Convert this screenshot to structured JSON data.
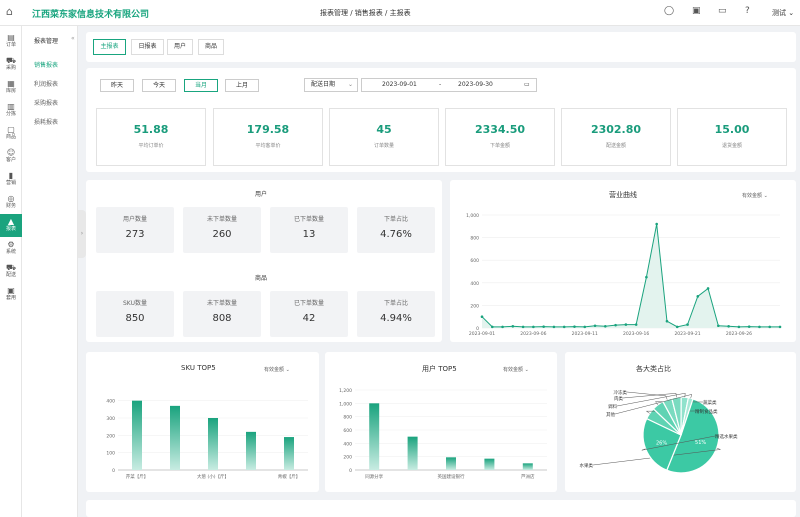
{
  "header": {
    "company": "江西菜东家信息技术有限公司",
    "breadcrumb": "报表管理 / 销售报表 / 主报表",
    "user": "测试 ⌄"
  },
  "sidebar": {
    "items": [
      {
        "label": "订单",
        "icon": "order-icon"
      },
      {
        "label": "采购",
        "icon": "cart-icon"
      },
      {
        "label": "库房",
        "icon": "warehouse-icon"
      },
      {
        "label": "分拣",
        "icon": "sort-icon"
      },
      {
        "label": "商品",
        "icon": "box-icon"
      },
      {
        "label": "客户",
        "icon": "customer-icon"
      },
      {
        "label": "营销",
        "icon": "marketing-icon"
      },
      {
        "label": "财务",
        "icon": "finance-icon"
      },
      {
        "label": "报表",
        "icon": "report-icon"
      },
      {
        "label": "系统",
        "icon": "system-icon"
      },
      {
        "label": "配送",
        "icon": "delivery-icon"
      },
      {
        "label": "套用",
        "icon": "apply-icon"
      }
    ],
    "active": 8
  },
  "subnav": {
    "title": "报表管理",
    "collapse": "«",
    "items": [
      "销售报表",
      "利润报表",
      "采购报表",
      "损耗报表"
    ],
    "active": 0
  },
  "tabs": [
    "主报表",
    "日报表",
    "用户",
    "商品"
  ],
  "period_buttons": [
    "昨天",
    "今天",
    "当月",
    "上月"
  ],
  "date_type": {
    "value": "配送日期",
    "arrow": "⌄"
  },
  "date_range": {
    "start": "2023-09-01",
    "sep": "-",
    "end": "2023-09-30",
    "icon": "calendar-icon"
  },
  "stats": [
    {
      "value": "51.88",
      "label": "平均订单价"
    },
    {
      "value": "179.58",
      "label": "平均客单价"
    },
    {
      "value": "45",
      "label": "订单数量"
    },
    {
      "value": "2334.50",
      "label": "下单金额"
    },
    {
      "value": "2302.80",
      "label": "配送金额"
    },
    {
      "value": "15.00",
      "label": "退货金额"
    }
  ],
  "user_section": {
    "title": "用户",
    "metrics": [
      {
        "label": "用户数量",
        "value": "273"
      },
      {
        "label": "未下单数量",
        "value": "260"
      },
      {
        "label": "已下单数量",
        "value": "13"
      },
      {
        "label": "下单占比",
        "value": "4.76%"
      }
    ]
  },
  "goods_section": {
    "title": "商品",
    "metrics": [
      {
        "label": "SKU数量",
        "value": "850"
      },
      {
        "label": "未下单数量",
        "value": "808"
      },
      {
        "label": "已下单数量",
        "value": "42"
      },
      {
        "label": "下单占比",
        "value": "4.94%"
      }
    ]
  },
  "filter_label": "有效金额",
  "filter_arrow": "⌄",
  "accent": "#19a57f",
  "chart_data": [
    {
      "type": "area",
      "title": "营业曲线",
      "yticks": [
        "0",
        "200",
        "400",
        "600",
        "800",
        "1,000"
      ],
      "ylim": [
        0,
        1000
      ],
      "xticks": [
        "2023-09-01",
        "2023-09-06",
        "2023-09-11",
        "2023-09-16",
        "2023-09-21",
        "2023-09-26"
      ],
      "values": [
        100,
        10,
        10,
        15,
        10,
        10,
        12,
        10,
        10,
        12,
        10,
        20,
        15,
        25,
        30,
        30,
        450,
        920,
        60,
        10,
        30,
        280,
        350,
        20,
        15,
        10,
        12,
        10,
        10,
        10
      ]
    },
    {
      "type": "bar",
      "title": "SKU TOP5",
      "yticks": [
        "0",
        "100",
        "200",
        "300",
        "400"
      ],
      "ylim": [
        0,
        450
      ],
      "categories": [
        "芹菜【斤】",
        "",
        "大葱 (小)【斤】",
        "",
        "青椒【斤】"
      ],
      "values": [
        400,
        370,
        300,
        220,
        190
      ]
    },
    {
      "type": "bar",
      "title": "用户 TOP5",
      "yticks": [
        "0",
        "200",
        "400",
        "600",
        "800",
        "1,000",
        "1,200"
      ],
      "ylim": [
        0,
        1200
      ],
      "categories": [
        "同源分享",
        "",
        "英国建设银行",
        "",
        "芦洲店"
      ],
      "values": [
        1000,
        500,
        190,
        170,
        100
      ]
    },
    {
      "type": "pie",
      "title": "各大类占比",
      "slices": [
        {
          "label": "水果类",
          "value": 51,
          "text": "51%"
        },
        {
          "label": "精选水果类",
          "value": 26,
          "text": "26%"
        },
        {
          "label": "精制食品类",
          "value": 5,
          "text": ""
        },
        {
          "label": "蔬菜类",
          "value": 5,
          "text": ""
        },
        {
          "label": "冷冻类",
          "value": 4,
          "text": ""
        },
        {
          "label": "肉类",
          "value": 4,
          "text": ""
        },
        {
          "label": "调料",
          "value": 3,
          "text": ""
        },
        {
          "label": "其他",
          "value": 2,
          "text": ""
        }
      ]
    }
  ]
}
